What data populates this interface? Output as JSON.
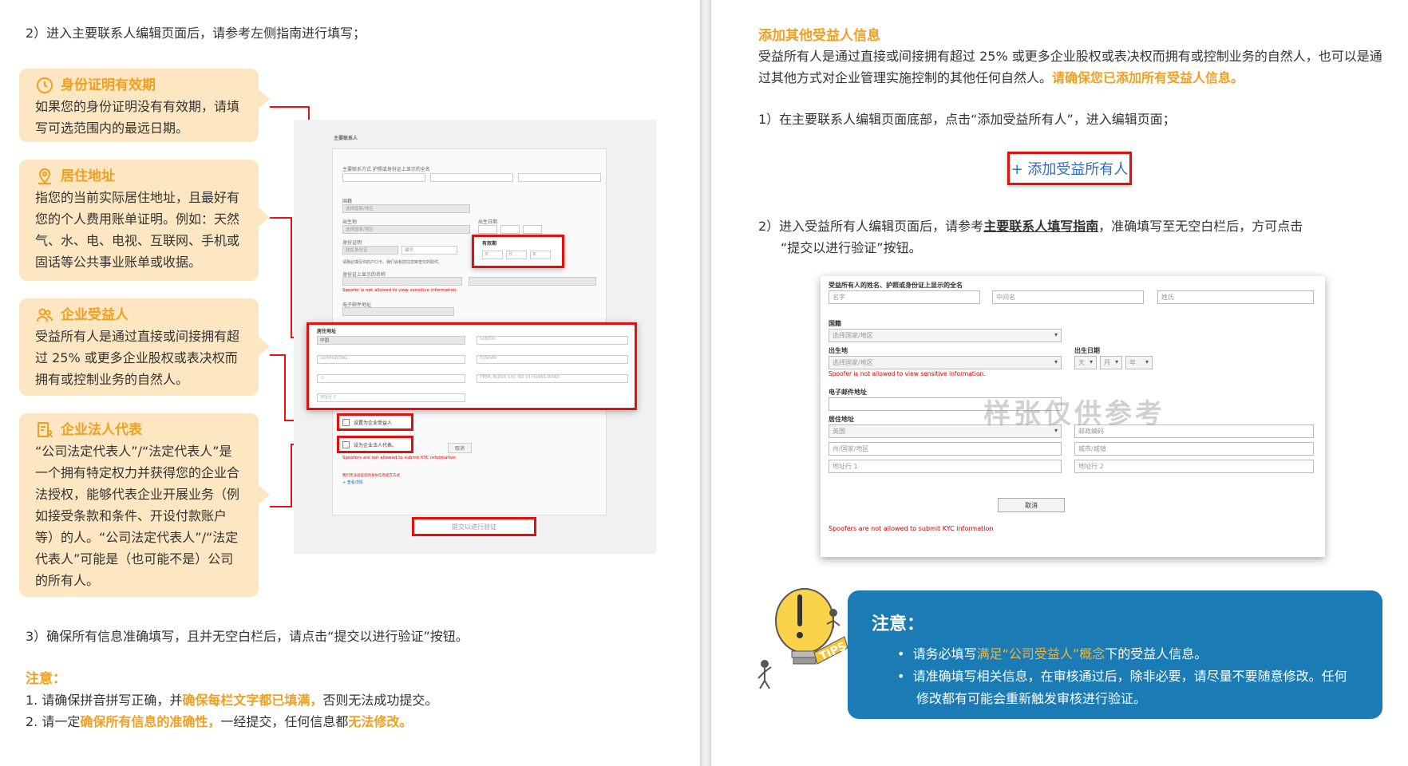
{
  "left": {
    "step2": "2）进入主要联系人编辑页面后，请参考左侧指南进行填写；",
    "cards": [
      {
        "title": "身份证明有效期",
        "body": "如果您的身份证明没有有效期，请填写可选范围内的最远日期。",
        "icon": "clock-icon"
      },
      {
        "title": "居住地址",
        "body": "指您的当前实际居住地址，且最好有您的个人费用账单证明。例如：天然气、水、电、电视、互联网、手机或固话等公共事业账单或收据。",
        "icon": "location-pin-icon"
      },
      {
        "title": "企业受益人",
        "body": "受益所有人是通过直接或间接拥有超过 25% 或更多企业股权或表决权而拥有或控制业务的自然人。",
        "icon": "users-icon"
      },
      {
        "title": "企业法人代表",
        "body": "“公司法定代表人”/“法定代表人”是一个拥有特定权力并获得您的企业合法授权，能够代表企业开展业务（例如接受条款和条件、开设付款账户等）的人。“公司法定代表人”/“法定代表人”可能是（也可能不是）公司的所有人。",
        "icon": "document-person-icon"
      }
    ],
    "shot": {
      "title": "主要联系人",
      "name_label": "主要联系方式 护照或身份证上显示的全名",
      "nation_label": "国籍",
      "nation_value": "选择国家/地区",
      "birthplace_label": "出生地",
      "birthplace_value": "选择国家/地区",
      "birthdate_label": "出生日期",
      "id_label": "身份证明",
      "id_value": "居民身份证",
      "id_no": "编号",
      "expiry_label": "有效期",
      "expiry_day": "天",
      "expiry_month": "月",
      "expiry_year": "年",
      "id_note": "请務必填写你的户口卡。我们会和前往您审查交的取件。",
      "name_on_id_label": "身份证上显示的名称",
      "spoof_error": "Spoofer is not allowed to view sensitive information",
      "email_label": "电子邮件地址",
      "address_label": "居住地址",
      "country": "中国",
      "postal": "528000",
      "province": "GUANGDONG",
      "city": "FOSHAN",
      "addr1": "三",
      "addr2": "YTEM, BLOCK 130, NO 13 HUANG ROAD",
      "addr3": "地址行 2",
      "beneficiary_check": "设置为企业受益人",
      "legal_rep_check": "设为企业法人代表。",
      "cancel": "取消",
      "kyc_error": "Spoofers are not allowed to submit KYC information",
      "small_error": "我们无法验证您的身份信息提交方式",
      "small_link": "+ 查看详情",
      "submit": "提交以进行验证"
    },
    "step3": "3）确保所有信息准确填写，且并无空白栏后，请点击“提交以进行验证”按钮。",
    "note_title": "注意：",
    "note1_a": "1. 请确保拼音拼写正确，并",
    "note1_b": "确保每栏文字都已填满，",
    "note1_c": "否则无法成功提交。",
    "note2_a": "2. 请一定",
    "note2_b": "确保所有信息的准确性，",
    "note2_c": "一经提交，任何信息都",
    "note2_d": "无法修改。"
  },
  "right": {
    "heading": "添加其他受益人信息",
    "intro_a": "受益所有人是通过直接或间接拥有超过 25% 或更多企业股权或表决权而拥有或控制业务的自然人，",
    "intro_b": "也可以是通过其他方式对企业管理实施控制的其他任何自然人。",
    "intro_c": "请确保您已添加所有受益人信息。",
    "step1": "1）在主要联系人编辑页面底部，点击“添加受益所有人”，进入编辑页面；",
    "add_button": "+ 添加受益所有人",
    "step2_a": "2）进入受益所有人编辑页面后，请参考",
    "step2_link": "主要联系人填写指南",
    "step2_b": "，准确填写至无空白栏后，方可点击",
    "step2_c": "“提交以进行验证”按钮。",
    "form": {
      "name_label": "受益所有人的姓名、护照或身份证上显示的全名",
      "first": "名字",
      "middle": "中间名",
      "last": "姓氏",
      "nation_label": "国籍",
      "nation_value": "选择国家/地区",
      "birthplace_label": "出生地",
      "birthplace_value": "选择国家/地区",
      "birthdate_label": "出生日期",
      "day": "天",
      "month": "月",
      "year": "年",
      "spoof_error": "Spoofer is not allowed to view sensitive information.",
      "email_label": "电子邮件地址",
      "address_label": "居住地址",
      "country": "英国",
      "postal": "邮政编码",
      "state": "州/国家/地区",
      "city": "城市/城镇",
      "addr1": "地址行 1",
      "addr2": "地址行 2",
      "cancel": "取消",
      "kyc_error": "Spoofers are not allowed to submit KYC information"
    },
    "watermark": "样张仅供参考",
    "tips_icon": "lightbulb-tips-icon",
    "tips_label": "TIPS",
    "note": {
      "title": "注意：",
      "item1_a": "请务必填写",
      "item1_hl": "满足“公司受益人”概念",
      "item1_b": "下的受益人信息。",
      "item2": "请准确填写相关信息，在审核通过后，除非必要，请尽量不要随意修改。任何修改都有可能会重新触发审核进行验证。"
    }
  }
}
